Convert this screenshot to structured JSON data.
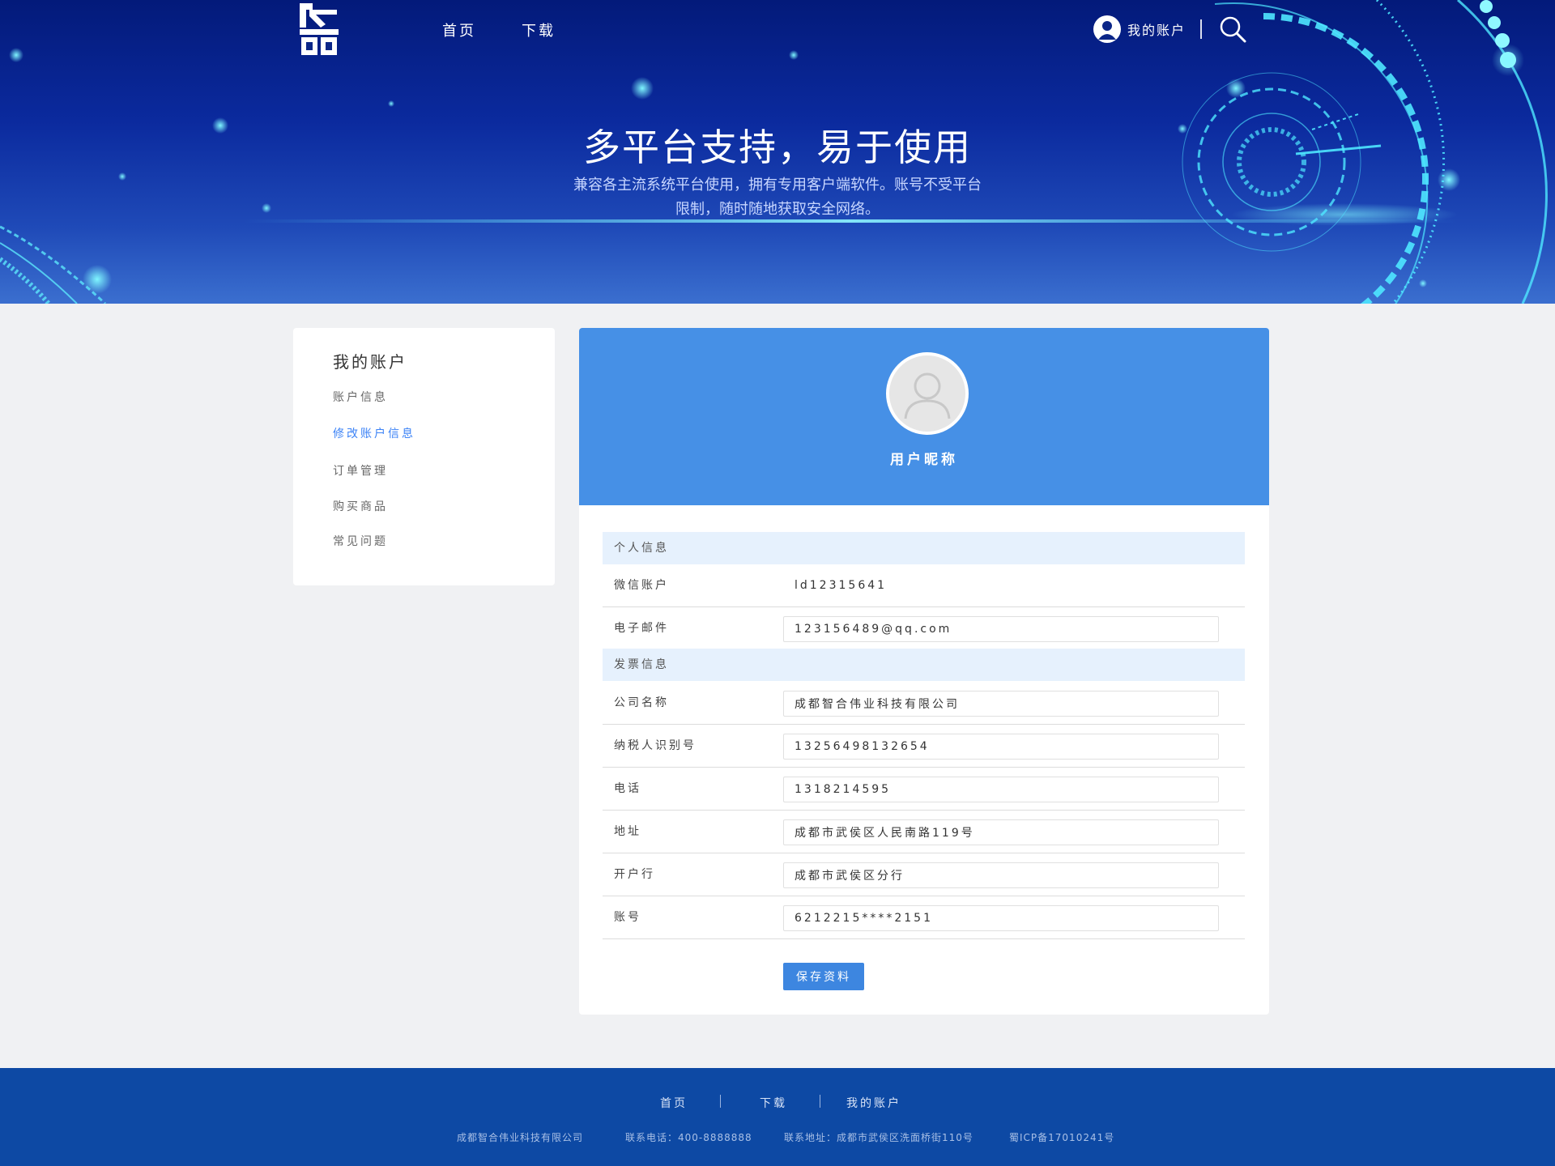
{
  "colors": {
    "hero_top": "#031a7a",
    "hero_bottom": "#3b6fcf",
    "card_header": "#4690e6",
    "section_bar": "#e6f1fd",
    "active_link": "#3b82f6",
    "button": "#3d86e0",
    "footer": "#0d49a4",
    "page_bg": "#f0f1f3"
  },
  "header": {
    "logo_icon": "brand-logo-icon",
    "nav": [
      "首页",
      "下载"
    ],
    "account_label": "我的账户",
    "search_icon": "search-icon"
  },
  "hero": {
    "title": "多平台支持，易于使用",
    "subtitle": "兼容各主流系统平台使用，拥有专用客户端软件。账号不受平台限制，随时随地获取安全网络。"
  },
  "sidebar": {
    "title": "我的账户",
    "items": [
      "账户信息",
      "修改账户信息",
      "订单管理",
      "购买商品",
      "常见问题"
    ],
    "active_index": 1
  },
  "profile": {
    "nickname": "用户昵称",
    "avatar_icon": "user-avatar-icon"
  },
  "sections": {
    "personal": "个人信息",
    "invoice": "发票信息"
  },
  "fields": {
    "wechat": {
      "label": "微信账户",
      "value": "ld12315641"
    },
    "email": {
      "label": "电子邮件",
      "value": "123156489@qq.com"
    },
    "company": {
      "label": "公司名称",
      "value": "成都智合伟业科技有限公司"
    },
    "tax_id": {
      "label": "纳税人识别号",
      "value": "13256498132654"
    },
    "phone": {
      "label": "电话",
      "value": "1318214595"
    },
    "address": {
      "label": "地址",
      "value": "成都市武侯区人民南路119号"
    },
    "bank": {
      "label": "开户行",
      "value": "成都市武侯区分行"
    },
    "account_no": {
      "label": "账号",
      "value": "6212215****2151"
    }
  },
  "save_label": "保存资料",
  "footer": {
    "links": [
      "首页",
      "下载",
      "我的账户"
    ],
    "company": "成都智合伟业科技有限公司",
    "phone": "联系电话：400-8888888",
    "address": "联系地址：成都市武侯区洗面桥街110号",
    "icp": "蜀ICP备17010241号"
  }
}
